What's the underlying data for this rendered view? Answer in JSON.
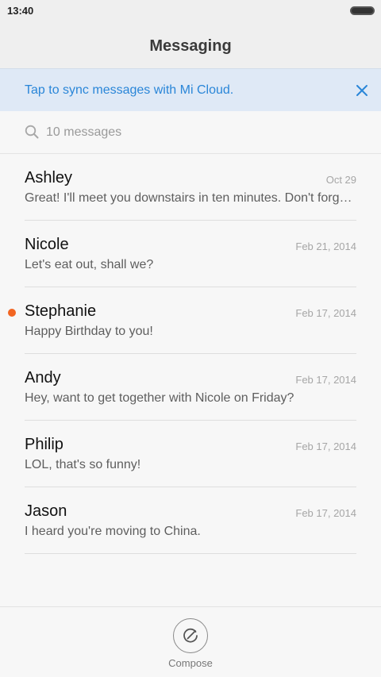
{
  "status_bar": {
    "time": "13:40"
  },
  "header": {
    "title": "Messaging"
  },
  "sync_banner": {
    "text": "Tap to sync messages with Mi Cloud."
  },
  "search": {
    "placeholder": "10 messages"
  },
  "messages": [
    {
      "name": "Ashley",
      "date": "Oct 29",
      "preview": "Great! I'll meet you downstairs in ten minutes. Don't forget your umbrella.",
      "unread": false
    },
    {
      "name": "Nicole",
      "date": "Feb 21, 2014",
      "preview": "Let's eat out, shall we?",
      "unread": false
    },
    {
      "name": "Stephanie",
      "date": "Feb 17, 2014",
      "preview": "Happy Birthday to you!",
      "unread": true
    },
    {
      "name": "Andy",
      "date": "Feb 17, 2014",
      "preview": "Hey, want to get together with Nicole on Friday?",
      "unread": false
    },
    {
      "name": "Philip",
      "date": "Feb 17, 2014",
      "preview": "LOL, that's so funny!",
      "unread": false
    },
    {
      "name": "Jason",
      "date": "Feb 17, 2014",
      "preview": "I heard you're moving to China.",
      "unread": false
    }
  ],
  "bottom_bar": {
    "compose_label": "Compose"
  },
  "colors": {
    "accent": "#2a86d8",
    "unread": "#f26522",
    "banner_bg": "#dfe9f6"
  },
  "icons": {
    "close": "close-icon",
    "search": "search-icon",
    "compose": "compose-icon"
  }
}
